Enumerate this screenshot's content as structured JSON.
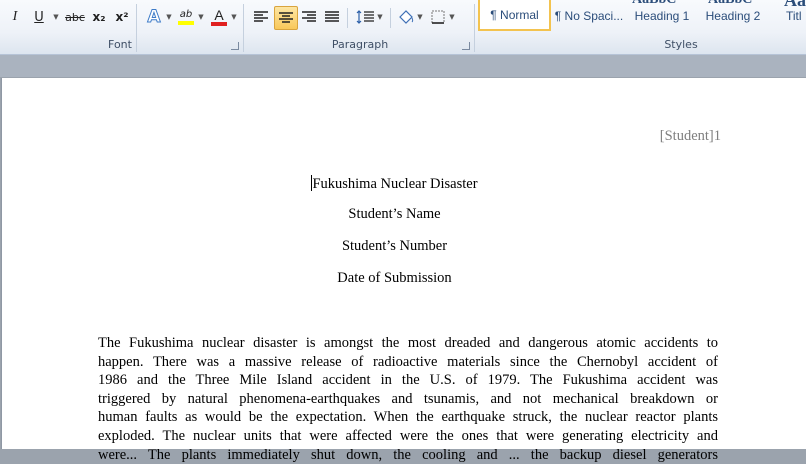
{
  "ribbon": {
    "font_group": {
      "label": "Font",
      "buttons": {
        "italic": "I",
        "underline": "U",
        "strikethrough": "abc",
        "subscript": "x₂",
        "superscript": "x²",
        "text_effects": "A",
        "highlight": "ab",
        "font_color": "A"
      },
      "highlight_color": "#ffff00",
      "font_color_value": "#e02020"
    },
    "paragraph_group": {
      "label": "Paragraph",
      "active_alignment": "center"
    },
    "styles_group": {
      "label": "Styles",
      "items": [
        {
          "label": "¶ Normal",
          "selected": true
        },
        {
          "label": "¶ No Spaci..."
        },
        {
          "label": "Heading 1"
        },
        {
          "label": "Heading 2"
        },
        {
          "label": "Titl"
        }
      ],
      "samples": [
        "AaBbC",
        "AaBbC",
        "AaB"
      ]
    }
  },
  "document": {
    "header": "[Student]1",
    "title_lines": [
      "Fukushima Nuclear Disaster",
      "Student’s Name",
      "Student’s Number",
      "Date of Submission"
    ],
    "paragraph_lines": [
      "The Fukushima nuclear disaster is amongst the most dreaded and dangerous atomic accidents to",
      "happen. There was a massive release of radioactive materials since the Chernobyl accident of",
      "1986 and the Three Mile Island accident in the U.S. of 1979.  The Fukushima accident was",
      "triggered by natural phenomena-earthquakes and tsunamis, and not mechanical breakdown or",
      "human faults as would be the expectation. When the earthquake struck, the nuclear reactor plants",
      "exploded. The nuclear units that were affected were the ones that were generating electricity and",
      "were... The plants immediately shut down, the cooling and ... the backup diesel generators"
    ]
  }
}
